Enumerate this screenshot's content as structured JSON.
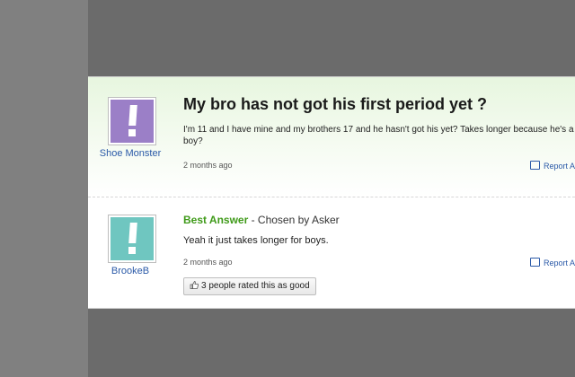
{
  "question": {
    "title": "My bro has not got his first period yet ?",
    "body": "I'm 11 and I have mine and my brothers 17 and he hasn't got his yet? Takes longer because he's a boy?",
    "asker_name": "Shoe Monster",
    "time": "2 months ago",
    "report_label": "Report A",
    "avatar_color": "#9b7fc7"
  },
  "answer": {
    "best_label": "Best Answer",
    "chosen_by": " - Chosen by Asker",
    "body": "Yeah it just takes longer for boys.",
    "answerer_name": "BrookeB",
    "time": "2 months ago",
    "report_label": "Report A",
    "rating_text": "3 people rated this as good",
    "avatar_color": "#6fc6c0"
  }
}
